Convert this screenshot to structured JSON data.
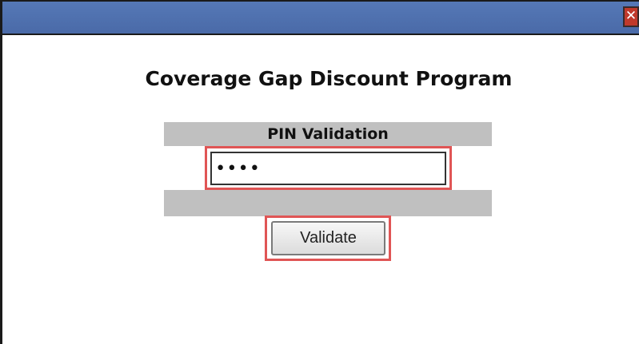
{
  "window": {
    "close_glyph": "✕"
  },
  "dialog": {
    "title": "Coverage Gap Discount Program",
    "pin_section_label": "PIN Validation",
    "pin_value": "1234",
    "validate_label": "Validate"
  },
  "colors": {
    "titlebar": "#4a6aa8",
    "close_button": "#c0392b",
    "highlight": "#e05555",
    "section_band": "#c0c0c0"
  }
}
